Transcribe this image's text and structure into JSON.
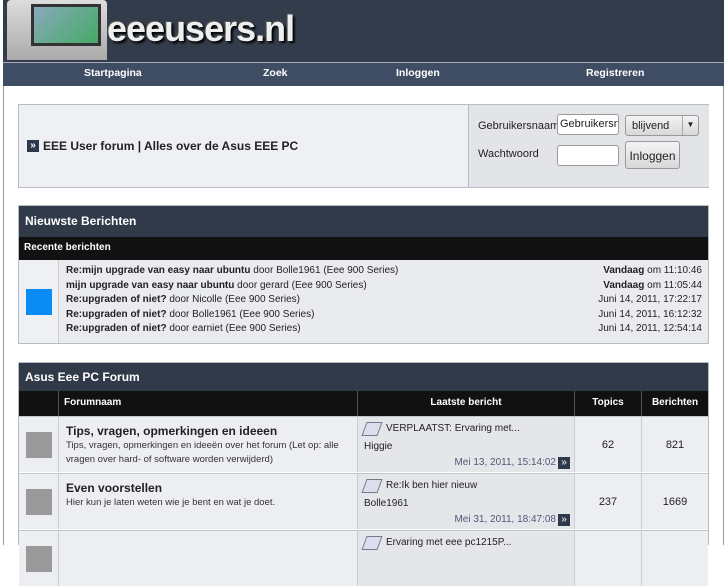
{
  "site": {
    "logo": "eeeusers.nl"
  },
  "nav": [
    "Startpagina",
    "Zoek",
    "Inloggen",
    "Registreren"
  ],
  "intro": {
    "title": "EEE User forum | Alles over de Asus EEE PC"
  },
  "login": {
    "username_label": "Gebruikersnaam",
    "username_value": "Gebruikersn",
    "duration": "blijvend",
    "password_label": "Wachtwoord",
    "password_value": "",
    "submit": "Inloggen"
  },
  "news": {
    "title": "Nieuwste Berichten",
    "subtitle": "Recente berichten",
    "icon_color": "#0a8cf5",
    "items": [
      {
        "topic": "Re:mijn upgrade van easy naar ubuntu",
        "by": "door",
        "user": "Bolle1961",
        "board": "(Eee 900 Series)",
        "date_bold": "Vandaag",
        "date": "om 11:10:46"
      },
      {
        "topic": "mijn upgrade van easy naar ubuntu",
        "by": "door",
        "user": "gerard",
        "board": "(Eee 900 Series)",
        "date_bold": "Vandaag",
        "date": "om 11:05:44"
      },
      {
        "topic": "Re:upgraden of niet?",
        "by": "door",
        "user": "Nicolle",
        "board": "(Eee 900 Series)",
        "date_bold": "",
        "date": "Juni 14, 2011, 17:22:17"
      },
      {
        "topic": "Re:upgraden of niet?",
        "by": "door",
        "user": "Bolle1961",
        "board": "(Eee 900 Series)",
        "date_bold": "",
        "date": "Juni 14, 2011, 16:12:32"
      },
      {
        "topic": "Re:upgraden of niet?",
        "by": "door",
        "user": "earniet",
        "board": "(Eee 900 Series)",
        "date_bold": "",
        "date": "Juni 14, 2011, 12:54:14"
      }
    ]
  },
  "forum": {
    "title": "Asus Eee PC Forum",
    "columns": [
      "Forumnaam",
      "Laatste bericht",
      "Topics",
      "Berichten"
    ],
    "rows": [
      {
        "name": "Tips, vragen, opmerkingen en ideeen",
        "desc": "Tips, vragen, opmerkingen en ideeën over het forum (Let op: alle vragen over hard- of software worden verwijderd)",
        "last_title": "VERPLAATST: Ervaring met...",
        "last_user": "Higgie",
        "last_date": "Mei 13, 2011, 15:14:02",
        "topics": "62",
        "posts": "821"
      },
      {
        "name": "Even voorstellen",
        "desc": "Hier kun je laten weten wie je bent en wat je doet.",
        "last_title": "Re:Ik ben hier nieuw",
        "last_user": "Bolle1961",
        "last_date": "Mei 31, 2011, 18:47:08",
        "topics": "237",
        "posts": "1669"
      },
      {
        "name": "",
        "desc": "",
        "last_title": "Ervaring met eee pc1215P...",
        "last_user": "",
        "last_date": "",
        "topics": "",
        "posts": ""
      }
    ]
  }
}
